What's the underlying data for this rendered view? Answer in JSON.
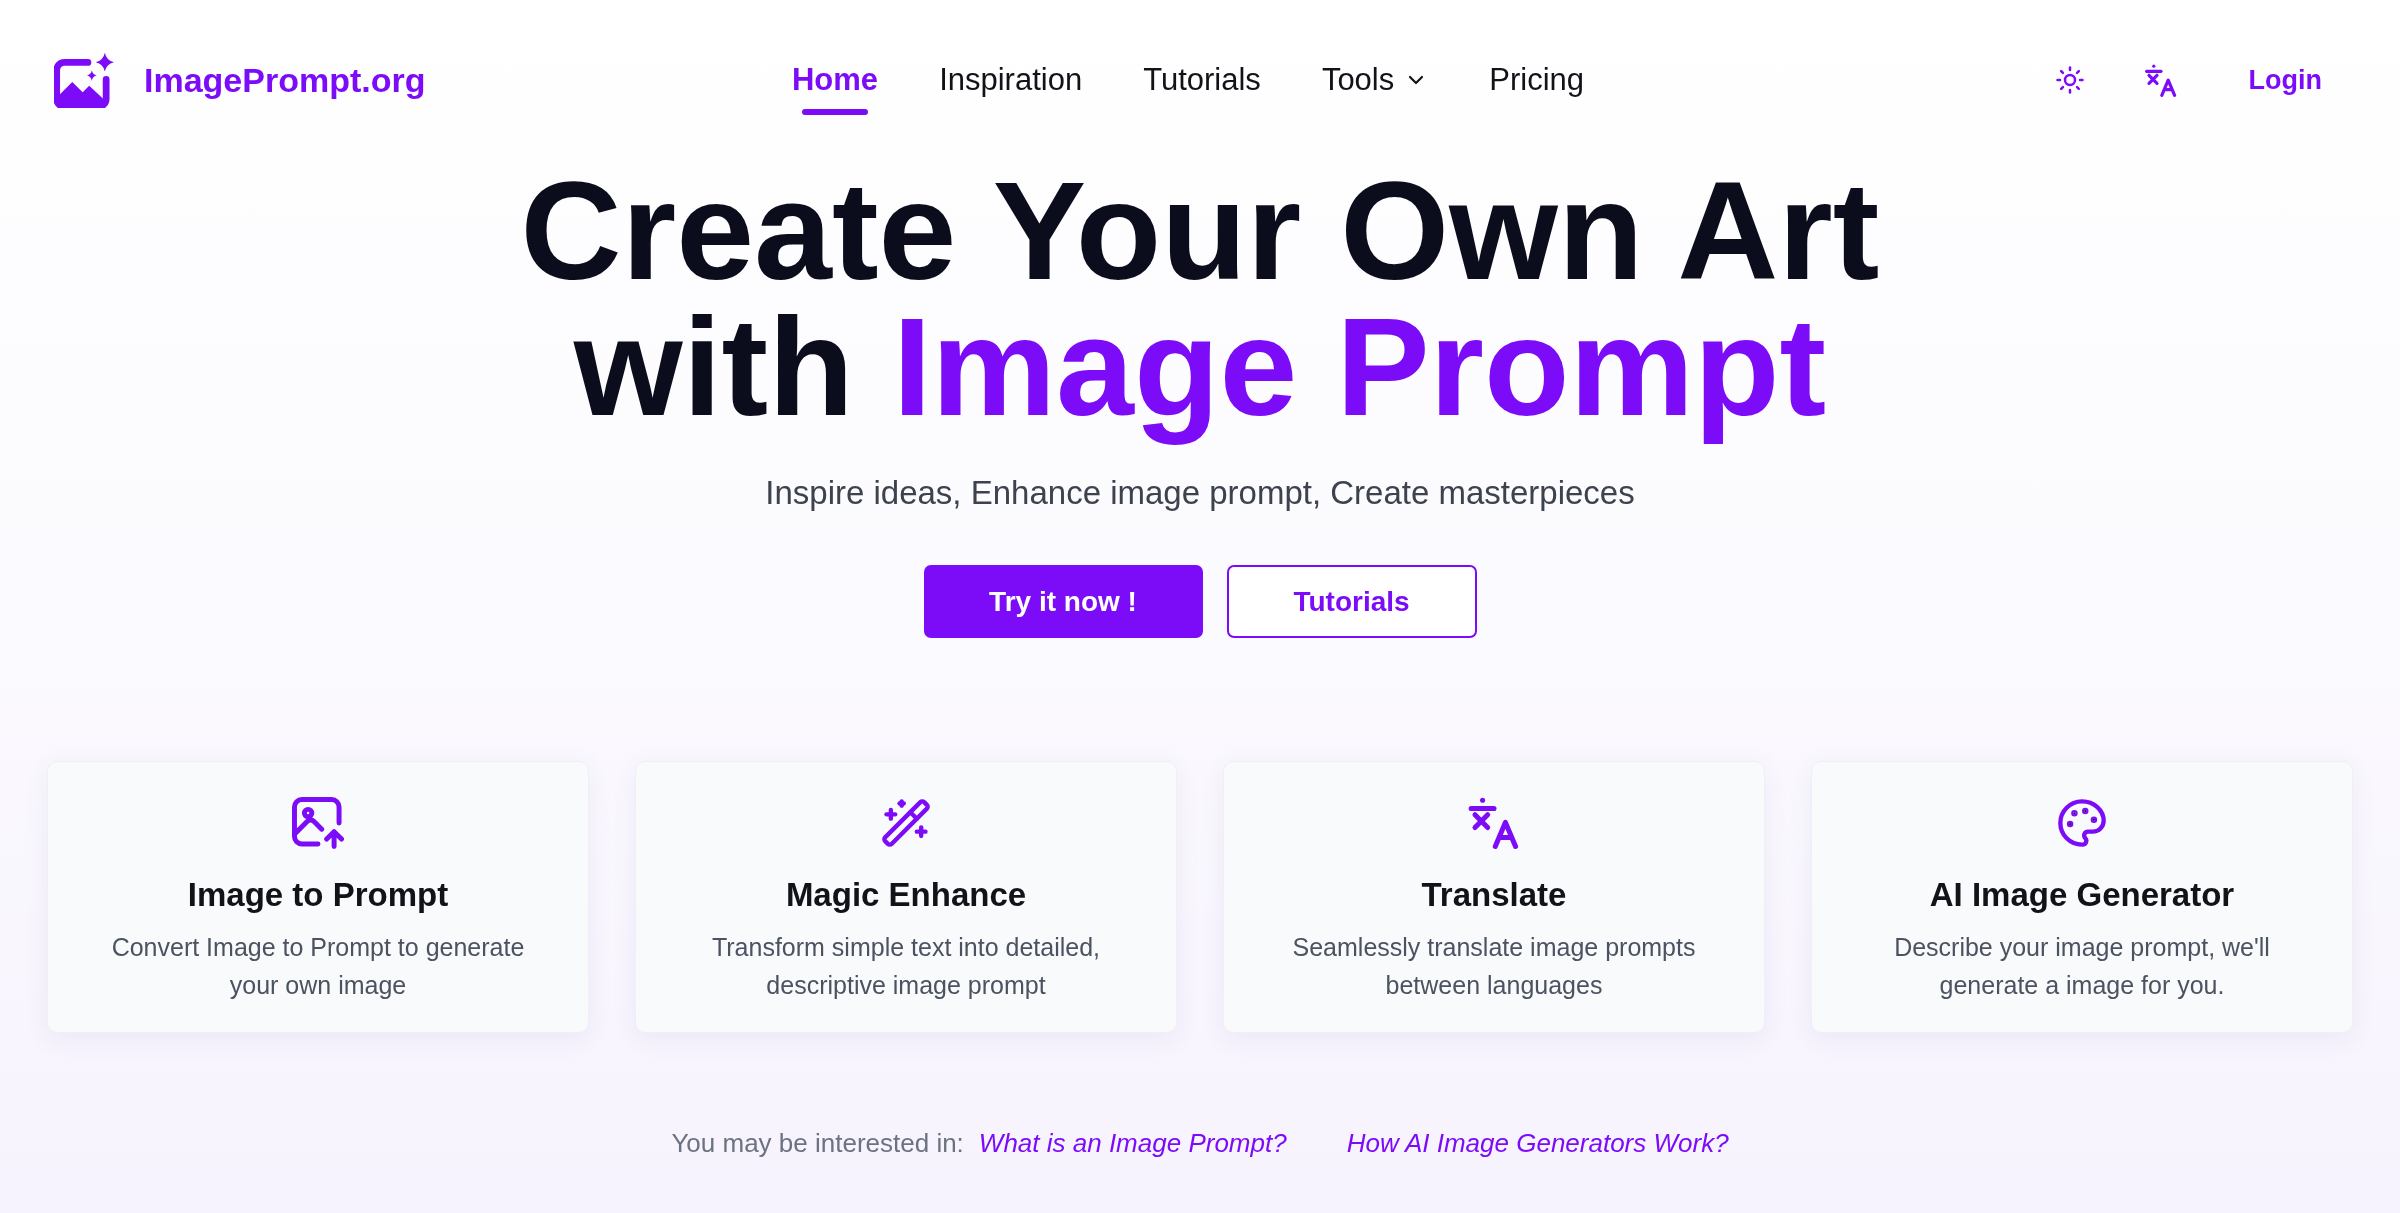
{
  "header": {
    "logo": {
      "text": "ImagePrompt.org"
    },
    "nav": [
      {
        "label": "Home",
        "selected": true,
        "kind": "link"
      },
      {
        "label": "Inspiration",
        "selected": false,
        "kind": "link"
      },
      {
        "label": "Tutorials",
        "selected": false,
        "kind": "link"
      },
      {
        "label": "Tools",
        "selected": false,
        "kind": "dropdown"
      },
      {
        "label": "Pricing",
        "selected": false,
        "kind": "link"
      }
    ],
    "login": "Login"
  },
  "hero": {
    "title_lines": [
      [
        {
          "text": "Create Your Own Art",
          "highlight": false
        }
      ],
      [
        {
          "text": "with",
          "highlight": false
        },
        {
          "text": "Image Prompt",
          "highlight": true
        }
      ]
    ],
    "subtitle": "Inspire ideas, Enhance image prompt, Create masterpieces",
    "buttons": [
      {
        "label": "Try it now !",
        "kind": "primary"
      },
      {
        "label": "Tutorials",
        "kind": "outline"
      }
    ]
  },
  "features": [
    {
      "title": "Image to Prompt",
      "description": "Convert Image to Prompt to generate your own image"
    },
    {
      "title": "Magic Enhance",
      "description": "Transform simple text into detailed, descriptive image prompt"
    },
    {
      "title": "Translate",
      "description": "Seamlessly translate image prompts between languages"
    },
    {
      "title": "AI Image Generator",
      "description": "Describe your image prompt, we'll generate a image for you."
    }
  ],
  "interest": {
    "label": "You may be interested in:",
    "links": [
      "What is an Image Prompt?",
      "How AI Image Generators Work?"
    ]
  }
}
